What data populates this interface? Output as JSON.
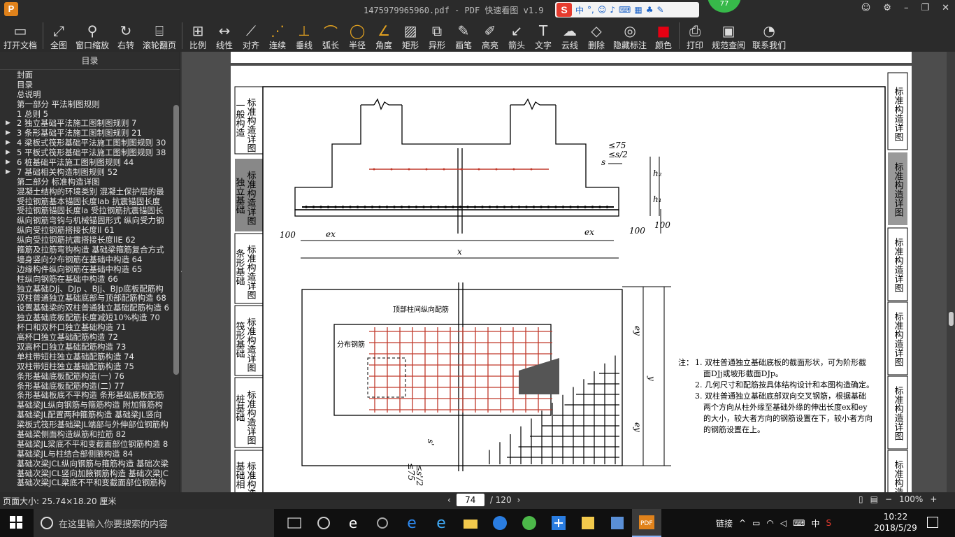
{
  "window": {
    "title": "1475979965960.pdf - PDF 快速看图 v1.9",
    "badge": "77",
    "ime_label": "中"
  },
  "toolbar": [
    {
      "label": "打开文档",
      "icon": "folder-icon"
    },
    {
      "label": "全图",
      "icon": "fullview-icon"
    },
    {
      "label": "窗口缩放",
      "icon": "zoom-icon"
    },
    {
      "label": "右转",
      "icon": "rotate-icon"
    },
    {
      "label": "滚轮翻页",
      "icon": "mouse-icon"
    },
    {
      "label": "比例",
      "icon": "scale-icon"
    },
    {
      "label": "线性",
      "icon": "linear-icon"
    },
    {
      "label": "对齐",
      "icon": "align-icon"
    },
    {
      "label": "连续",
      "icon": "continuous-icon"
    },
    {
      "label": "垂线",
      "icon": "perpendicular-icon"
    },
    {
      "label": "弧长",
      "icon": "arc-icon"
    },
    {
      "label": "半径",
      "icon": "radius-icon"
    },
    {
      "label": "角度",
      "icon": "angle-icon"
    },
    {
      "label": "矩形",
      "icon": "rect-icon"
    },
    {
      "label": "异形",
      "icon": "polygon-icon"
    },
    {
      "label": "画笔",
      "icon": "pen-icon"
    },
    {
      "label": "高亮",
      "icon": "highlight-icon"
    },
    {
      "label": "箭头",
      "icon": "arrow-icon"
    },
    {
      "label": "文字",
      "icon": "text-icon"
    },
    {
      "label": "云线",
      "icon": "cloud-icon"
    },
    {
      "label": "删除",
      "icon": "eraser-icon"
    },
    {
      "label": "隐藏标注",
      "icon": "eye-hide-icon"
    },
    {
      "label": "颜色",
      "icon": "color-icon"
    },
    {
      "label": "打印",
      "icon": "print-icon"
    },
    {
      "label": "规范查阅",
      "icon": "book-icon"
    },
    {
      "label": "联系我们",
      "icon": "contact-icon"
    }
  ],
  "sidebar": {
    "title": "目录",
    "items": [
      {
        "label": "封面",
        "arrow": false
      },
      {
        "label": "目录",
        "arrow": false
      },
      {
        "label": "总说明",
        "arrow": false
      },
      {
        "label": "第一部分  平法制图规则",
        "arrow": false
      },
      {
        "label": "1 总则 5",
        "arrow": false
      },
      {
        "label": "2 独立基础平法施工图制图规则 7",
        "arrow": true
      },
      {
        "label": "3 条形基础平法施工图制图规则 21",
        "arrow": true
      },
      {
        "label": "4 梁板式筏形基础平法施工图制图规则 30",
        "arrow": true
      },
      {
        "label": "5 平板式筏形基础平法施工图制图规则 38",
        "arrow": true
      },
      {
        "label": "6 桩基础平法施工图制图规则 44",
        "arrow": true
      },
      {
        "label": "7 基础相关构造制图规则 52",
        "arrow": true
      },
      {
        "label": "第二部分  标准构造详图",
        "arrow": false
      },
      {
        "label": "混凝土结构的环境类别 混凝土保护层的最",
        "arrow": false
      },
      {
        "label": "受拉钢筋基本锚固长度lab 抗震锚固长度",
        "arrow": false
      },
      {
        "label": "受拉钢筋锚固长度la 受拉钢筋抗震锚固长",
        "arrow": false
      },
      {
        "label": "纵向钢筋弯钩与机械锚固形式 纵向受力钢",
        "arrow": false
      },
      {
        "label": "纵向受拉钢筋搭接长度ll 61",
        "arrow": false
      },
      {
        "label": "纵向受拉钢筋抗震搭接长度llE 62",
        "arrow": false
      },
      {
        "label": "箍筋及拉筋弯钩构造 基础梁箍筋复合方式",
        "arrow": false
      },
      {
        "label": "墙身竖向分布钢筋在基础中构造 64",
        "arrow": false
      },
      {
        "label": "边缘构件纵向钢筋在基础中构造 65",
        "arrow": false
      },
      {
        "label": "柱纵向钢筋在基础中构造 66",
        "arrow": false
      },
      {
        "label": "独立基础DJj、DJp 、BJj、BJp底板配筋构",
        "arrow": false
      },
      {
        "label": "双柱普通独立基础底部与顶部配筋构造 68",
        "arrow": false
      },
      {
        "label": "设置基础梁的双柱普通独立基础配筋构造 6",
        "arrow": false
      },
      {
        "label": "独立基础底板配筋长度减短10%构造 70",
        "arrow": false
      },
      {
        "label": "杯口和双杯口独立基础构造 71",
        "arrow": false
      },
      {
        "label": "高杯口独立基础配筋构造 72",
        "arrow": false
      },
      {
        "label": "双高杯口独立基础配筋构造 73",
        "arrow": false
      },
      {
        "label": "单柱带短柱独立基础配筋构造 74",
        "arrow": false
      },
      {
        "label": "双柱带短柱独立基础配筋构造 75",
        "arrow": false
      },
      {
        "label": "条形基础底板配筋构造(一) 76",
        "arrow": false
      },
      {
        "label": "条形基础底板配筋构造(二) 77",
        "arrow": false
      },
      {
        "label": "条形基础板底不平构造 条形基础底板配筋",
        "arrow": false
      },
      {
        "label": "基础梁JL纵向钢筋与箍筋构造 附加箍筋构",
        "arrow": false
      },
      {
        "label": "基础梁JL配置两种箍筋构造 基础梁JL竖向",
        "arrow": false
      },
      {
        "label": "梁板式筏形基础梁JL端部与外伸部位钢筋构",
        "arrow": false
      },
      {
        "label": "基础梁侧面构造纵筋和拉筋 82",
        "arrow": false
      },
      {
        "label": "基础梁JL梁底不平和变截面部位钢筋构造 8",
        "arrow": false
      },
      {
        "label": "基础梁JL与柱结合部侧腋构造 84",
        "arrow": false
      },
      {
        "label": "基础次梁JCL纵向钢筋与箍筋构造 基础次梁",
        "arrow": false
      },
      {
        "label": "基础次梁JCL竖向加腋钢筋构造 基础次梁JC",
        "arrow": false
      },
      {
        "label": "基础次梁JCL梁底不平和变截面部位钢筋构",
        "arrow": false
      }
    ]
  },
  "document": {
    "left_tabs": [
      "标准构造详图 一般构造",
      "标准构造详图 独立基础",
      "标准构造详图 条形基础",
      "标准构造详图 筏形基础",
      "标准构造详图 桩基础",
      "标准构造详图 基础相关"
    ],
    "right_tabs": [
      "标准构造详图",
      "标准构造详图",
      "标准构造详图",
      "标准构造详图",
      "标准构造详图",
      "标准构造详图"
    ],
    "labels": {
      "top_gap": "≤75",
      "top_gap2": "≤s/2",
      "s": "s",
      "h2": "h₂",
      "h1": "h₁",
      "dim100a": "100",
      "dim100b": "100",
      "dim100c": "100",
      "ex1": "ex",
      "ex2": "ex",
      "x": "x",
      "ey1": "ey",
      "ey2": "ey",
      "y": "y",
      "s_prime": "s'",
      "top_rebar": "顶部柱间纵向配筋",
      "dist_rebar": "分布钢筋",
      "bot75": "≤75",
      "bot_s2": "≤s'/2"
    },
    "notes": {
      "prefix": "注：",
      "n1": "1. 双柱普通独立基础底板的截面形状，可为阶形截",
      "n1b": "面DJj或坡形截面DJp。",
      "n2": "2. 几何尺寸和配筋按具体结构设计和本图构造确定。",
      "n3": "3. 双柱普通独立基础底部双向交叉钢筋，根据基础",
      "n3b": "两个方向从柱外缘至基础外缘的伸出长度ex和ey",
      "n3c": "的大小，较大者方向的钢筋设置在下，较小者方向",
      "n3d": "的钢筋设置在上。"
    }
  },
  "status": {
    "page_size": "页面大小: 25.74×18.20 厘米",
    "current_page": "74",
    "total_pages": "/ 120",
    "zoom": "100%"
  },
  "taskbar": {
    "search_placeholder": "在这里输入你要搜索的内容",
    "tray_link": "链接",
    "ime": "中",
    "time": "10:22",
    "date": "2018/5/29"
  }
}
